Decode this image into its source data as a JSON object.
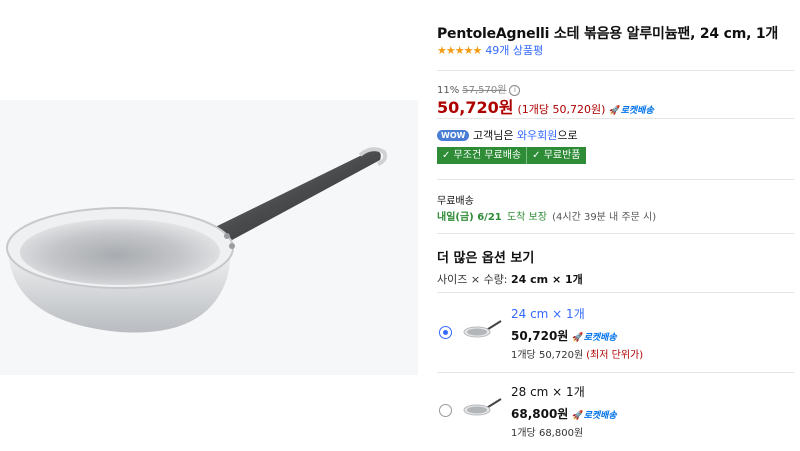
{
  "product": {
    "title": "PentoleAgnelli 소테 볶음용 알루미늄팬, 24 cm, 1개",
    "stars": "★★★★★",
    "review_count": "49개 상품평"
  },
  "pricing": {
    "discount_rate": "11%",
    "original_price": "57,570원",
    "info_icon": "i",
    "sale_price": "50,720원",
    "unit_price": "(1개당 50,720원)",
    "rocket_icon": "🚀",
    "rocket_label": "로켓배송"
  },
  "membership": {
    "badge": "WOW",
    "text_prefix": "고객님은",
    "link": "와우회원",
    "text_suffix": "으로"
  },
  "shipping_tags": [
    "✓ 무조건 무료배송",
    "✓ 무료반품"
  ],
  "delivery": {
    "label": "무료배송",
    "date": "내일(금) 6/21",
    "status": "도착 보장",
    "note": "(4시간 39분 내 주문 시)"
  },
  "options": {
    "title": "더 많은 옵션 보기",
    "size_label": "사이즈 × 수량:",
    "size_value": "24 cm × 1개",
    "items": [
      {
        "name": "24 cm × 1개",
        "price": "50,720원",
        "rocket": "로켓배송",
        "unit_prefix": "1개당",
        "unit": "50,720원",
        "lowest": "(최저 단위가)",
        "selected": true
      },
      {
        "name": "28 cm × 1개",
        "price": "68,800원",
        "rocket": "로켓배송",
        "unit_prefix": "1개당",
        "unit": "68,800원",
        "lowest": "",
        "selected": false
      }
    ]
  },
  "colors": {
    "price_red": "#ae0000",
    "link_blue": "#346aff",
    "ship_green": "#2e8b36",
    "star_orange": "#f39c12"
  }
}
